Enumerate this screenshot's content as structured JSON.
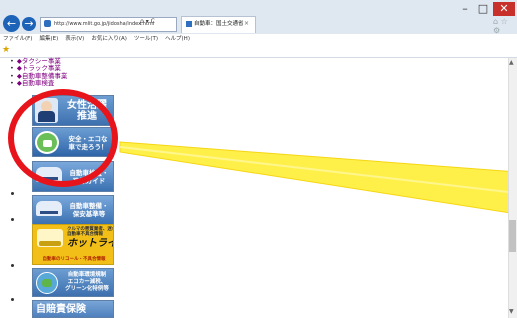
{
  "window": {
    "minimize_glyph": "–",
    "maximize_glyph": "□",
    "close_glyph": "✕",
    "toolbar_icons": "⌂ ☆ ⚙"
  },
  "browser": {
    "back_glyph": "←",
    "forward_glyph": "→",
    "address": "http://www.mlit.go.jp/jidosha/index.html",
    "address_tools": "ρ ▾ C",
    "tab_title": "自動車：国土交通省",
    "tab_close": "×",
    "favorites_icon": "star-icon"
  },
  "menubar": [
    "ファイル(F)",
    "編集(E)",
    "表示(V)",
    "お気に入り(A)",
    "ツール(T)",
    "ヘルプ(H)"
  ],
  "links": [
    "◆タクシー事業",
    "◆トラック事業",
    "◆自動車整備事業",
    "◆自動車検査"
  ],
  "banners": {
    "b1": "女性活躍\n推進",
    "b2": "安全・エコな\n車で走ろう！",
    "b3": "自動車検査・\n登録ガイド",
    "b4": "自動車整備・\n保安基準等",
    "b5_top": "クルマの悪質業者、迷わずに！\n自動車不具合情報",
    "b5_title": "ホットライン",
    "b5_sub": "自動車のリコール・不具合情報",
    "b6": "自動車環境規制\nエコカー減税、\nグリーン化特例等",
    "b7": "自賠責保険"
  },
  "colors": {
    "highlight_ring": "#e8141b",
    "callout_fill": "#ffef3a",
    "link_visited": "#800080"
  }
}
